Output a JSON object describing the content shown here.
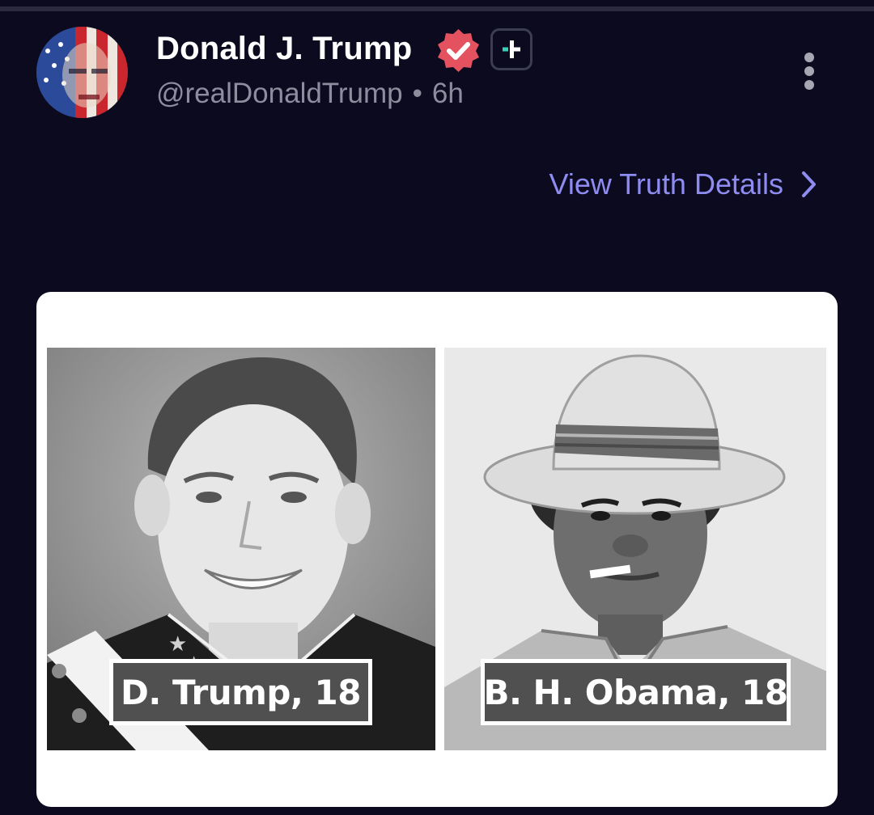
{
  "post": {
    "author_name": "Donald J. Trump",
    "handle": "@realDonaldTrump",
    "separator": "•",
    "time_ago": "6h",
    "view_details_label": "View Truth Details"
  },
  "media": {
    "left_caption": "D. Trump, 18",
    "right_caption": "B. H. Obama, 18"
  },
  "icons": {
    "verified": "verified-badge-icon",
    "plus": "plus-badge-icon",
    "more": "more-vertical-icon",
    "chevron": "chevron-right-icon"
  },
  "colors": {
    "background": "#0b0a1f",
    "verified": "#e4515f",
    "link": "#8e8cf0",
    "plus_accent": "#36d4b4"
  }
}
